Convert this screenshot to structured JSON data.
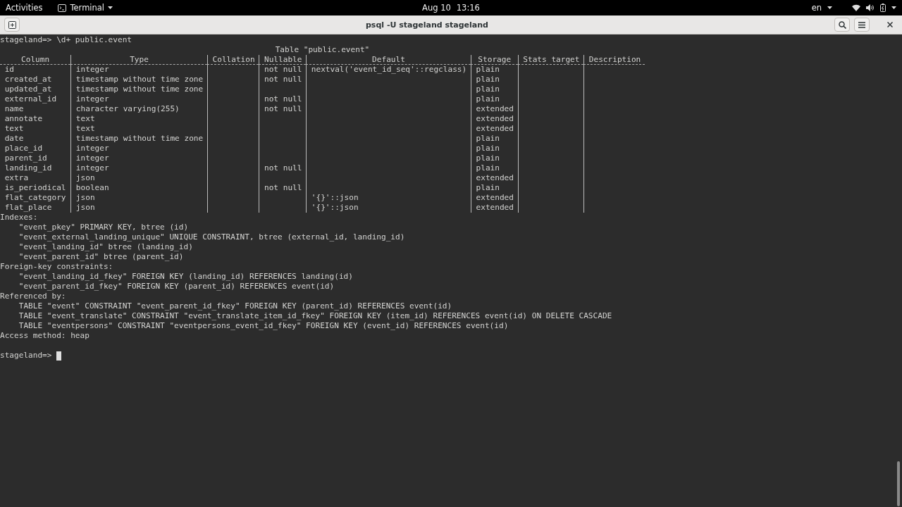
{
  "top_bar": {
    "activities": "Activities",
    "app_menu": "Terminal",
    "date": "Aug 10",
    "time": "13:16",
    "input_source": "en"
  },
  "window": {
    "title": "psql -U stageland stageland"
  },
  "terminal": {
    "command_line": "stageland=> \\d+ public.event",
    "table": {
      "title": "Table \"public.event\"",
      "columns": [
        "Column",
        "Type",
        "Collation",
        "Nullable",
        "Default",
        "Storage",
        "Stats target",
        "Description"
      ],
      "rows": [
        [
          "id",
          "integer",
          null,
          "not null",
          "nextval('event_id_seq'::regclass)",
          "plain",
          null,
          null
        ],
        [
          "created_at",
          "timestamp without time zone",
          null,
          "not null",
          null,
          "plain",
          null,
          null
        ],
        [
          "updated_at",
          "timestamp without time zone",
          null,
          null,
          null,
          "plain",
          null,
          null
        ],
        [
          "external_id",
          "integer",
          null,
          "not null",
          null,
          "plain",
          null,
          null
        ],
        [
          "name",
          "character varying(255)",
          null,
          "not null",
          null,
          "extended",
          null,
          null
        ],
        [
          "annotate",
          "text",
          null,
          null,
          null,
          "extended",
          null,
          null
        ],
        [
          "text",
          "text",
          null,
          null,
          null,
          "extended",
          null,
          null
        ],
        [
          "date",
          "timestamp without time zone",
          null,
          null,
          null,
          "plain",
          null,
          null
        ],
        [
          "place_id",
          "integer",
          null,
          null,
          null,
          "plain",
          null,
          null
        ],
        [
          "parent_id",
          "integer",
          null,
          null,
          null,
          "plain",
          null,
          null
        ],
        [
          "landing_id",
          "integer",
          null,
          "not null",
          null,
          "plain",
          null,
          null
        ],
        [
          "extra",
          "json",
          null,
          null,
          null,
          "extended",
          null,
          null
        ],
        [
          "is_periodical",
          "boolean",
          null,
          "not null",
          null,
          "plain",
          null,
          null
        ],
        [
          "flat_category",
          "json",
          null,
          null,
          "'{}'::json",
          "extended",
          null,
          null
        ],
        [
          "flat_place",
          "json",
          null,
          null,
          "'{}'::json",
          "extended",
          null,
          null
        ]
      ]
    },
    "sections": [
      {
        "heading": "Indexes:",
        "items": [
          "\"event_pkey\" PRIMARY KEY, btree (id)",
          "\"event_external_landing_unique\" UNIQUE CONSTRAINT, btree (external_id, landing_id)",
          "\"event_landing_id\" btree (landing_id)",
          "\"event_parent_id\" btree (parent_id)"
        ]
      },
      {
        "heading": "Foreign-key constraints:",
        "items": [
          "\"event_landing_id_fkey\" FOREIGN KEY (landing_id) REFERENCES landing(id)",
          "\"event_parent_id_fkey\" FOREIGN KEY (parent_id) REFERENCES event(id)"
        ]
      },
      {
        "heading": "Referenced by:",
        "items": [
          "TABLE \"event\" CONSTRAINT \"event_parent_id_fkey\" FOREIGN KEY (parent_id) REFERENCES event(id)",
          "TABLE \"event_translate\" CONSTRAINT \"event_translate_item_id_fkey\" FOREIGN KEY (item_id) REFERENCES event(id) ON DELETE CASCADE",
          "TABLE \"eventpersons\" CONSTRAINT \"eventpersons_event_id_fkey\" FOREIGN KEY (event_id) REFERENCES event(id)"
        ]
      }
    ],
    "footer": "Access method: heap",
    "prompt": "stageland=>"
  }
}
